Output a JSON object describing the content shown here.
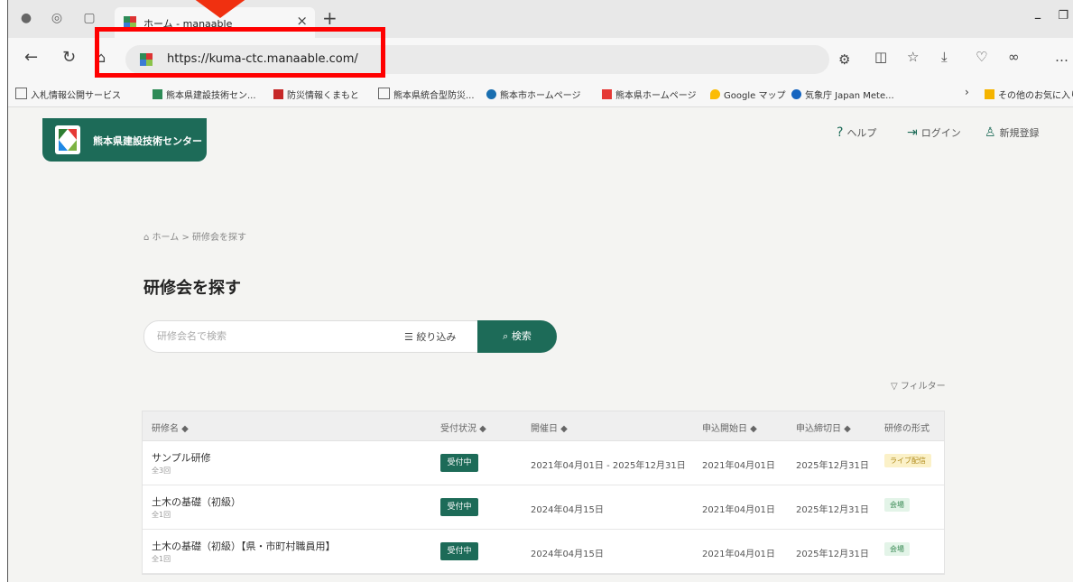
{
  "browser": {
    "tab_title": "ホーム - manaable",
    "close": "×",
    "new_tab": "+",
    "url": "https://kuma-ctc.manaable.com/",
    "bookmarks": [
      {
        "label": "入札情報公開サービス"
      },
      {
        "label": "熊本県建設技術セン..."
      },
      {
        "label": "防災情報くまもと"
      },
      {
        "label": "熊本県統合型防災..."
      },
      {
        "label": "熊本市ホームページ"
      },
      {
        "label": "熊本県ホームページ"
      },
      {
        "label": "Google マップ"
      },
      {
        "label": "気象庁 Japan Mete..."
      },
      {
        "label": "その他のお気に入り"
      }
    ]
  },
  "site": {
    "name": "熊本県建設技術センター",
    "nav": {
      "help": "ヘルプ",
      "login": "ログイン",
      "register": "新規登録"
    },
    "brand_color": "#1d6b58"
  },
  "breadcrumb": {
    "home": "ホーム",
    "sep": ">",
    "current": "研修会を探す"
  },
  "page_title": "研修会を探す",
  "search": {
    "placeholder": "研修会名で検索",
    "filter": "絞り込み",
    "button": "検索"
  },
  "filter_link": "フィルター",
  "table": {
    "headers": [
      "研修名 ◆",
      "受付状況 ◆",
      "開催日 ◆",
      "申込開始日 ◆",
      "申込締切日 ◆",
      "研修の形式"
    ],
    "rows": [
      {
        "name": "サンプル研修",
        "count": "全3回",
        "status": "受付中",
        "date": "2021年04月01日 - 2025年12月31日",
        "start": "2021年04月01日",
        "end": "2025年12月31日",
        "format": "ライブ配信"
      },
      {
        "name": "土木の基礎（初級）",
        "count": "全1回",
        "status": "受付中",
        "date": "2024年04月15日",
        "start": "2021年04月01日",
        "end": "2025年12月31日",
        "format": "会場"
      },
      {
        "name": "土木の基礎（初級）【県・市町村職員用】",
        "count": "全1回",
        "status": "受付中",
        "date": "2024年04月15日",
        "start": "2021年04月01日",
        "end": "2025年12月31日",
        "format": "会場"
      }
    ]
  }
}
